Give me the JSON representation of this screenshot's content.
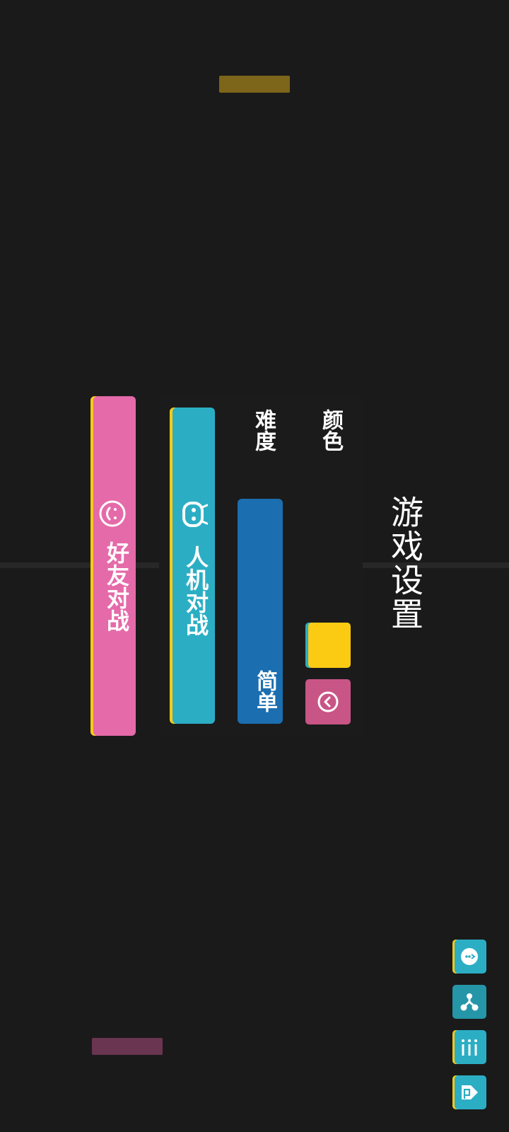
{
  "settings": {
    "title": "游戏设置",
    "color_label": "颜色",
    "difficulty_label": "难度",
    "difficulty_value": "简单",
    "selected_color": "#fbcb14"
  },
  "modes": {
    "ai_label": "人机对战",
    "friend_label": "好友对战"
  },
  "colors": {
    "background": "#1a1a1a",
    "accent_yellow": "#fbcb14",
    "accent_cyan": "#2baec4",
    "accent_pink": "#e56aa9",
    "accent_blue": "#1b6eaf",
    "paddle_top": "#7d6519",
    "paddle_bottom": "#6a3550"
  },
  "side_buttons": [
    {
      "icon": "chat-bubble-icon"
    },
    {
      "icon": "share-icon"
    },
    {
      "icon": "bar-menu-icon"
    },
    {
      "icon": "exit-door-icon"
    }
  ]
}
